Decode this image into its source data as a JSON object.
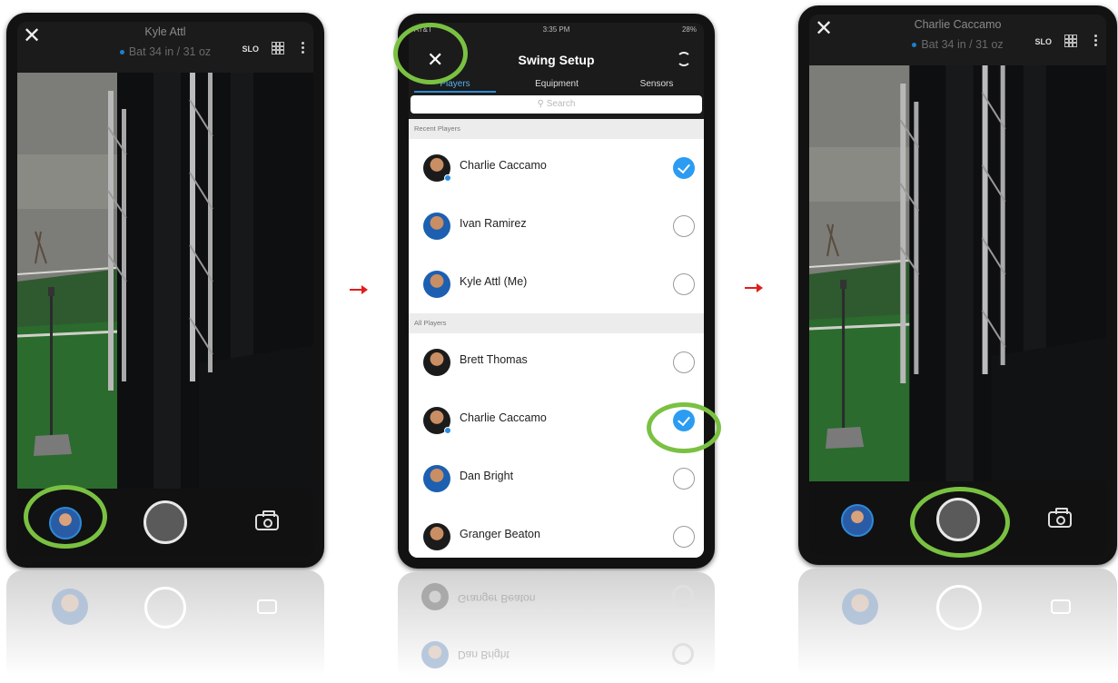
{
  "phone_left": {
    "player_name": "Kyle Attl",
    "bat_info": "Bat 34 in / 31 oz",
    "slo_label": "SLO"
  },
  "phone_middle": {
    "status": {
      "carrier": "AT&T",
      "time": "3:35 PM",
      "battery": "28%"
    },
    "title": "Swing Setup",
    "tabs": [
      {
        "label": "Players",
        "active": true
      },
      {
        "label": "Equipment",
        "active": false
      },
      {
        "label": "Sensors",
        "active": false
      }
    ],
    "search_placeholder": "Search",
    "sections": [
      {
        "title": "Recent Players",
        "players": [
          {
            "name": "Charlie Caccamo",
            "selected": true
          },
          {
            "name": "Ivan Ramirez",
            "selected": false
          },
          {
            "name": "Kyle Attl (Me)",
            "selected": false
          }
        ]
      },
      {
        "title": "All Players",
        "players": [
          {
            "name": "Brett Thomas",
            "selected": false
          },
          {
            "name": "Charlie Caccamo",
            "selected": true
          },
          {
            "name": "Dan Bright",
            "selected": false
          },
          {
            "name": "Granger Beaton",
            "selected": false
          }
        ]
      }
    ]
  },
  "phone_right": {
    "player_name": "Charlie Caccamo",
    "bat_info": "Bat 34 in / 31 oz",
    "slo_label": "SLO"
  },
  "reflection_text": {
    "line1": "Granger Beaton",
    "line2": "Dan Bright"
  },
  "colors": {
    "highlight_ring": "#7ac142",
    "arrow": "#e31b1b",
    "check_selected": "#2b9cf2",
    "tab_active": "#55aef0"
  }
}
